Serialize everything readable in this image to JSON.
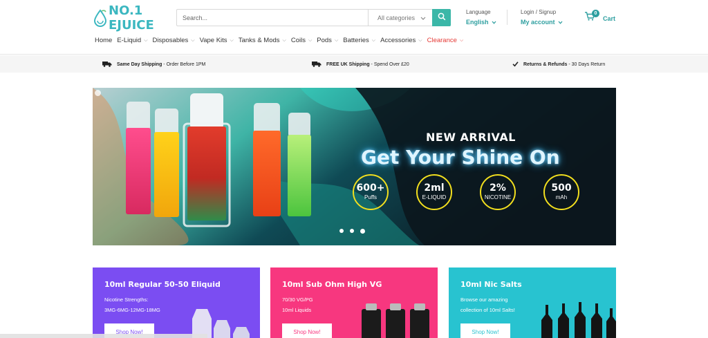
{
  "header": {
    "logo_text": "NO.1 EJUICE",
    "search": {
      "placeholder": "Search...",
      "category": "All categories"
    },
    "language": {
      "label": "Language",
      "value": "English"
    },
    "account": {
      "label": "Login / Signup",
      "value": "My account"
    },
    "cart": {
      "count": "0",
      "label": "Cart"
    },
    "nav": [
      {
        "label": "Home",
        "has_menu": false
      },
      {
        "label": "E-Liquid",
        "has_menu": true
      },
      {
        "label": "Disposables",
        "has_menu": true
      },
      {
        "label": "Vape Kits",
        "has_menu": true
      },
      {
        "label": "Tanks & Mods",
        "has_menu": true
      },
      {
        "label": "Coils",
        "has_menu": true
      },
      {
        "label": "Pods",
        "has_menu": true
      },
      {
        "label": "Batteries",
        "has_menu": true
      },
      {
        "label": "Accessories",
        "has_menu": true
      },
      {
        "label": "Clearance",
        "has_menu": true
      }
    ]
  },
  "infobar": [
    {
      "icon": "truck-icon",
      "bold": "Same Day Shipping",
      "rest": " - Order Before 1PM"
    },
    {
      "icon": "truck-icon",
      "bold": "FREE UK Shipping",
      "rest": " - Spend Over £20"
    },
    {
      "icon": "check-icon",
      "bold": "Returns & Refunds",
      "rest": " - 30 Days Return"
    }
  ],
  "hero": {
    "product_labels": [
      "ONE",
      "STRAWBERRY BURST",
      "ONE",
      "KIWI PASSION FRUIT",
      "ONE",
      "WATERMELON ICE"
    ],
    "kicker": "NEW ARRIVAL",
    "headline": "Get Your Shine On",
    "badges": [
      {
        "big": "600+",
        "small": "Puffs"
      },
      {
        "big": "2ml",
        "small": "E-LIQUID"
      },
      {
        "big": "2%",
        "small": "NICOTINE"
      },
      {
        "big": "500",
        "small": "mAh"
      }
    ],
    "slides": 3,
    "active_slide": 3
  },
  "cards": [
    {
      "title": "10ml Regular 50-50 Eliquid",
      "lines": [
        "Nicotine Strengths:",
        "3MG-6MG-12MG-18MG"
      ],
      "button": "Shop Now!",
      "color": "#7b4df2"
    },
    {
      "title": "10ml Sub Ohm High VG",
      "lines": [
        "70/30 VG/PG",
        "10ml Liquids"
      ],
      "button": "Shop Now!",
      "color": "#f7377f"
    },
    {
      "title": "10ml Nic Salts",
      "lines": [
        "Browse our amazing",
        "collection of 10ml Salts!"
      ],
      "button": "Shop Now!",
      "color": "#28c3d0"
    }
  ],
  "colors": {
    "accent": "#2e9fa0",
    "search_button": "#3bb7a8",
    "clearance": "#e53935",
    "badge_ring": "#f2df1e"
  }
}
